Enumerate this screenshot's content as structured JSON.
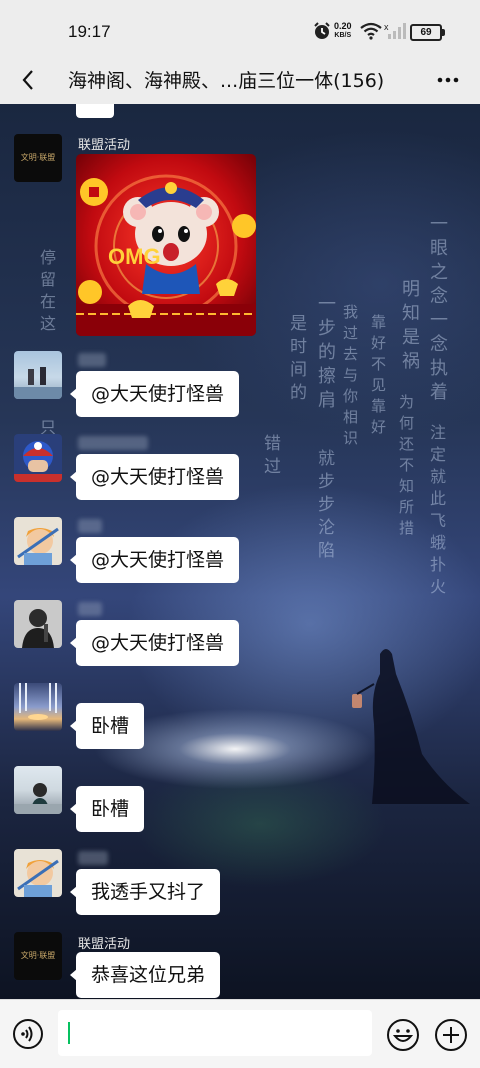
{
  "status": {
    "time": "19:17",
    "speed_value": "0.20",
    "speed_unit": "KB/S",
    "battery": "69",
    "icons": [
      "alarm-icon",
      "wifi-icon",
      "signal-icon",
      "battery-icon"
    ]
  },
  "header": {
    "title": "海神阁、海神殿、...庙三位一体(156)",
    "back_icon": "chevron-left-icon",
    "more_icon": "more-dots-icon"
  },
  "messages": [
    {
      "sender": "联盟活动",
      "type": "sticker",
      "sticker_text": "OMG"
    },
    {
      "type": "text",
      "text": "@大天使打怪兽"
    },
    {
      "type": "text",
      "text": "@大天使打怪兽"
    },
    {
      "type": "text",
      "text": "@大天使打怪兽"
    },
    {
      "type": "text",
      "text": "@大天使打怪兽"
    },
    {
      "type": "text",
      "text": "卧槽"
    },
    {
      "type": "text",
      "text": "卧槽"
    },
    {
      "type": "text",
      "text": "我透手又抖了"
    },
    {
      "sender": "联盟活动",
      "type": "text",
      "text": "恭喜这位兄弟"
    }
  ],
  "avatars": {
    "league_logo_text": "文明·联盟"
  },
  "background_poem": {
    "col1": "一眼之念一念执着",
    "col2": "注定就此飞蛾扑火",
    "col3": "明知是祸",
    "col4": "为何还不知所措",
    "col5": "靠好不见靠好",
    "col6": "我过去与你相识",
    "col7": "一步的擦肩",
    "col8": "就步步沦陷",
    "col9": "是时间的",
    "col10": "错过",
    "col11": "停留在这",
    "col12": "只有深"
  },
  "input": {
    "placeholder": "",
    "voice_icon": "voice-icon",
    "emoji_icon": "emoji-icon",
    "plus_icon": "plus-icon"
  },
  "colors": {
    "bar_bg": "#ededed",
    "bubble_bg": "#ffffff",
    "accent": "#07c160"
  }
}
